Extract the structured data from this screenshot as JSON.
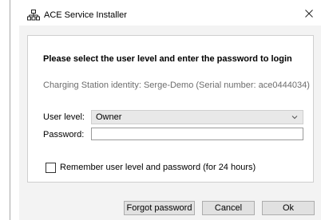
{
  "window": {
    "title": "ACE Service Installer",
    "close_symbol": "✕"
  },
  "dialog": {
    "heading": "Please select the user level and enter the password to login",
    "identity_text": "Charging Station identity: Serge-Demo (Serial number: ace0444034)",
    "user_level_label": "User level:",
    "user_level_value": "Owner",
    "password_label": "Password:",
    "password_value": "",
    "remember_label": "Remember user level and password (for 24 hours)",
    "remember_checked": false
  },
  "buttons": {
    "forgot": "Forgot password",
    "cancel": "Cancel",
    "ok": "Ok"
  },
  "icons": {
    "app": "network-icon",
    "close": "close-icon",
    "dropdown": "chevron-down-icon"
  }
}
